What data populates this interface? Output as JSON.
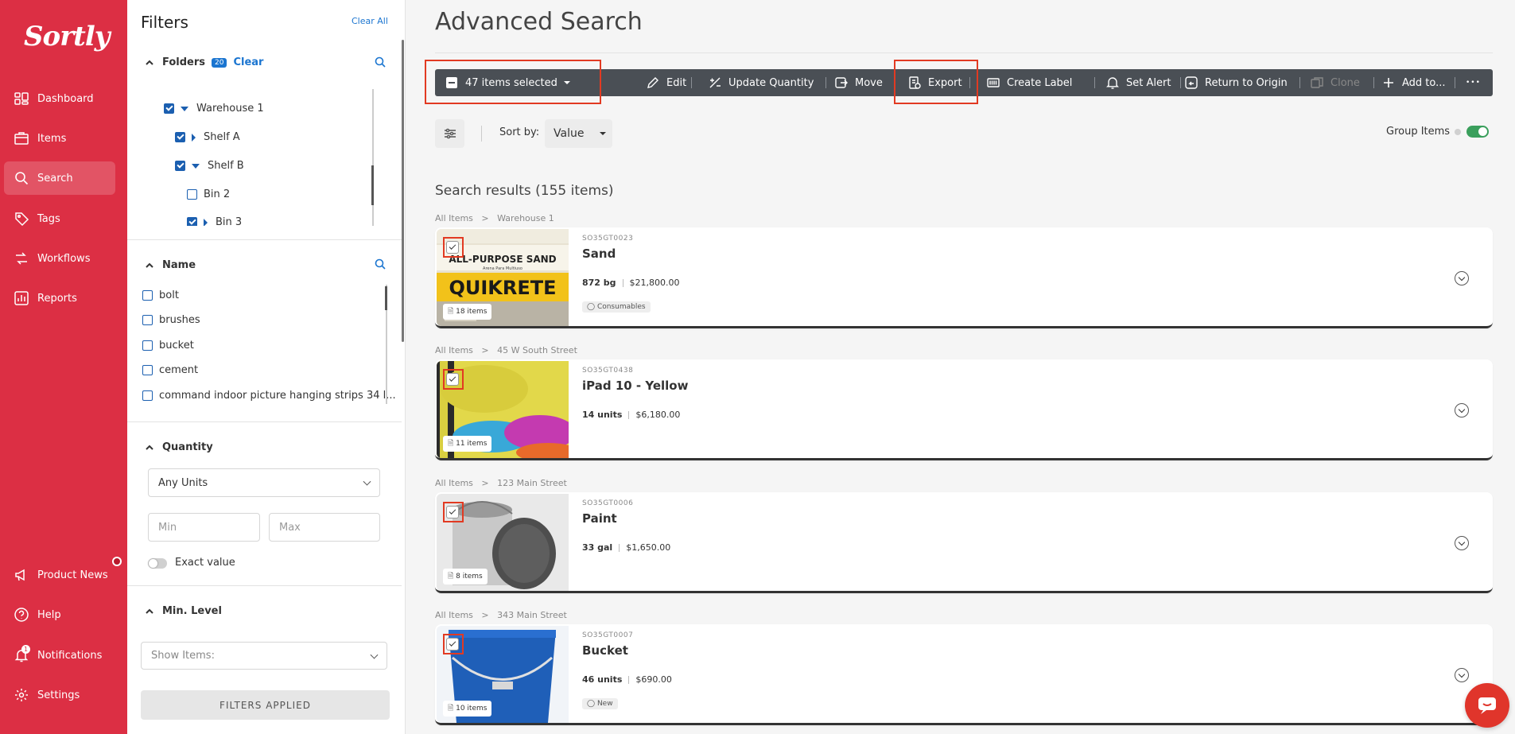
{
  "app": {
    "logo": "Sortly"
  },
  "sidebar": {
    "items": [
      {
        "label": "Dashboard",
        "icon": "dashboard-icon"
      },
      {
        "label": "Items",
        "icon": "items-icon"
      },
      {
        "label": "Search",
        "icon": "search-icon",
        "active": true
      },
      {
        "label": "Tags",
        "icon": "tag-icon"
      },
      {
        "label": "Workflows",
        "icon": "workflows-icon"
      },
      {
        "label": "Reports",
        "icon": "reports-icon"
      },
      {
        "label": "Product News",
        "icon": "megaphone-icon"
      },
      {
        "label": "Help",
        "icon": "help-icon"
      },
      {
        "label": "Notifications",
        "icon": "bell-icon",
        "badge": "1"
      },
      {
        "label": "Settings",
        "icon": "gear-icon"
      }
    ]
  },
  "filters": {
    "title": "Filters",
    "clear_all": "Clear All",
    "folders": {
      "label": "Folders",
      "count": "20",
      "clear": "Clear",
      "tree": [
        {
          "label": "Warehouse 1",
          "checked": true
        },
        {
          "label": "Shelf A",
          "checked": true
        },
        {
          "label": "Shelf B",
          "checked": true
        },
        {
          "label": "Bin 2",
          "checked": false
        },
        {
          "label": "Bin 3",
          "checked": true
        }
      ]
    },
    "name": {
      "label": "Name",
      "options": [
        "bolt",
        "brushes",
        "bucket",
        "cement",
        "command indoor picture hanging strips 34 l..."
      ]
    },
    "quantity": {
      "label": "Quantity",
      "units": "Any Units",
      "min_placeholder": "Min",
      "max_placeholder": "Max",
      "exact_value": "Exact value"
    },
    "min_level": {
      "label": "Min. Level",
      "placeholder": "Show Items:"
    },
    "applied_button": "FILTERS APPLIED"
  },
  "main": {
    "title": "Advanced Search",
    "toolbar": {
      "selected": "47 items selected",
      "edit": "Edit",
      "update_quantity": "Update Quantity",
      "move": "Move",
      "export": "Export",
      "create_label": "Create Label",
      "set_alert": "Set Alert",
      "return_to_origin": "Return to Origin",
      "clone": "Clone",
      "add_to": "Add to...",
      "more": "•••"
    },
    "sort": {
      "label": "Sort by:",
      "value": "Value"
    },
    "group_items": "Group Items",
    "results_title": "Search results (155 items)",
    "results": [
      {
        "crumb_root": "All Items",
        "crumb_folder": "Warehouse 1",
        "sku": "SO35GT0023",
        "name": "Sand",
        "qty": "872 bg",
        "value": "$21,800.00",
        "tag": "Consumables",
        "count": "18 items"
      },
      {
        "crumb_root": "All Items",
        "crumb_folder": "45 W South Street",
        "sku": "SO35GT0438",
        "name": "iPad 10 - Yellow",
        "qty": "14 units",
        "value": "$6,180.00",
        "tag": "",
        "count": "11 items"
      },
      {
        "crumb_root": "All Items",
        "crumb_folder": "123 Main Street",
        "sku": "SO35GT0006",
        "name": "Paint",
        "qty": "33 gal",
        "value": "$1,650.00",
        "tag": "",
        "count": "8 items"
      },
      {
        "crumb_root": "All Items",
        "crumb_folder": "343 Main Street",
        "sku": "SO35GT0007",
        "name": "Bucket",
        "qty": "46 units",
        "value": "$690.00",
        "tag": "New",
        "count": "10 items"
      }
    ],
    "sand_bag_text": {
      "line1": "ALL-PURPOSE SAND",
      "line2": "Arena Para Multiuso",
      "brand": "QUIKRETE"
    }
  },
  "colors": {
    "brand": "#dc2f44",
    "link": "#1b75d0",
    "toolbar": "#4a4f55",
    "highlight": "#e23a22",
    "toggle_on": "#3a9f5c"
  }
}
